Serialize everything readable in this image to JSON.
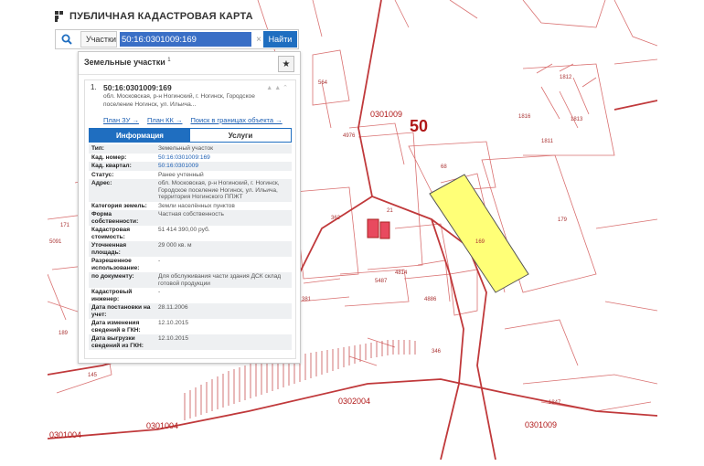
{
  "app": {
    "title": "ПУБЛИЧНАЯ КАДАСТРОВАЯ КАРТА"
  },
  "search": {
    "type_label": "Участки",
    "value": "50:16:0301009:169",
    "find_label": "Найти",
    "clear_symbol": "×"
  },
  "panel": {
    "title": "Земельные участки",
    "count": "1",
    "star_symbol": "★",
    "result": {
      "number": "1.",
      "cad_number": "50:16:0301009:169",
      "address": "обл. Московская, р-н Ногинский, г. Ногинск, Городское поселение Ногинск, ул. Ильича...",
      "links": [
        "План ЗУ →",
        "План КК →",
        "Поиск в границах объекта →"
      ],
      "tabs": [
        "Информация",
        "Услуги"
      ],
      "rows": [
        {
          "k": "Тип:",
          "v": "Земельный участок"
        },
        {
          "k": "Кад. номер:",
          "v": "50:16:0301009:169"
        },
        {
          "k": "Кад. квартал:",
          "v": "50:16:0301009"
        },
        {
          "k": "Статус:",
          "v": "Ранее учтенный"
        },
        {
          "k": "Адрес:",
          "v": "обл. Московская, р-н Ногинский, г. Ногинск, Городское поселение Ногинск, ул. Ильича, территория Ногинского ППЖТ"
        },
        {
          "k": "Категория земель:",
          "v": "Земли населённых пунктов"
        },
        {
          "k": "Форма собственности:",
          "v": "Частная собственность"
        },
        {
          "k": "Кадастровая стоимость:",
          "v": "51 414 390,00 руб."
        },
        {
          "k": "Уточненная площадь:",
          "v": "29 000 кв. м"
        },
        {
          "k": "Разрешенное использование:",
          "v": "-"
        },
        {
          "k": "по документу:",
          "v": "Для обслуживания части здания ДСК склад готовой продукции"
        },
        {
          "k": "Кадастровый инженер:",
          "v": "-"
        },
        {
          "k": "Дата постановки на учет:",
          "v": "28.11.2006"
        },
        {
          "k": "Дата изменения сведений в ГКН:",
          "v": "12.10.2015"
        },
        {
          "k": "Дата выгрузки сведений из ГКН:",
          "v": "12.10.2015"
        }
      ]
    }
  },
  "map": {
    "labels": {
      "district": "50",
      "q1": "0301009",
      "q2": "0302004",
      "q3": "0301004",
      "q4": "0301004",
      "q5": "0301009",
      "p169": "169",
      "p179": "179",
      "p68": "68",
      "p4976": "4976",
      "p362": "362",
      "p21": "21",
      "p4814": "4814",
      "p4886": "4886",
      "p5487": "5487",
      "p1847": "1847",
      "p1812": "1812",
      "p1816": "1816",
      "p1811": "1811",
      "p171": "171",
      "p189": "189",
      "p145": "145",
      "p346": "346",
      "p381": "381",
      "p564": "564",
      "p5091": "5091",
      "p1813": "1813"
    },
    "colors": {
      "line": "#c0393b",
      "highlight": "#ffff77",
      "building": "#e84a5f"
    }
  }
}
